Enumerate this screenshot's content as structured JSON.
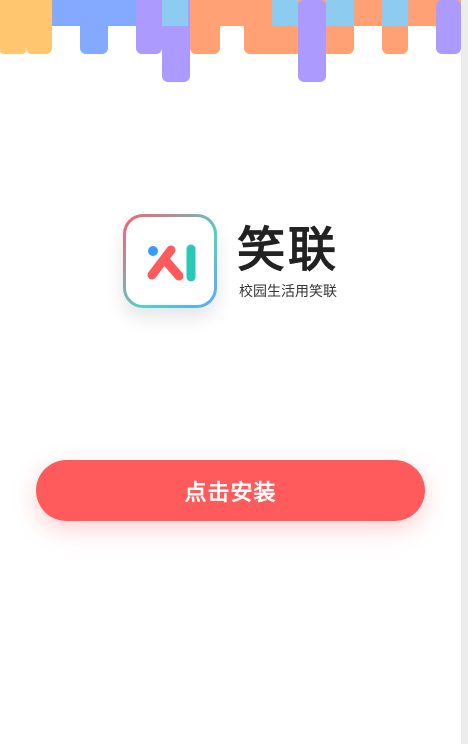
{
  "app": {
    "name": "笑联",
    "tagline": "校园生活用笑联",
    "icon": "xiaolian-logo-icon"
  },
  "actions": {
    "install_label": "点击安装"
  },
  "colors": {
    "primary": "#ff5a5c",
    "title_text": "#222222",
    "banner_orange": "#ffa175",
    "banner_yellow": "#ffc56f",
    "banner_blue": "#83aaff",
    "banner_purple": "#ad9aff",
    "banner_light_blue": "#8ecbf0"
  }
}
